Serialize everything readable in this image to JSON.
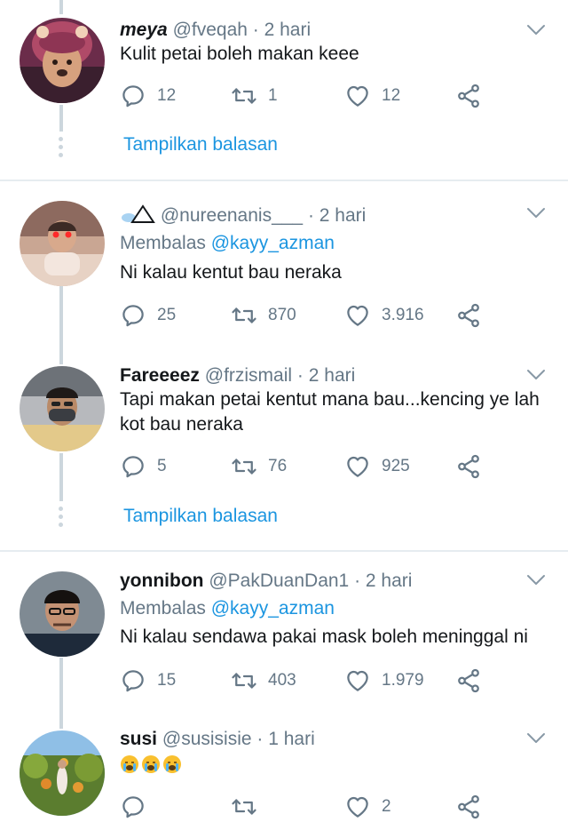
{
  "tweets": [
    {
      "name": "meya",
      "handle": "@fveqah",
      "time": "· 2 hari",
      "text": "Kulit petai boleh makan keee",
      "replies": "12",
      "retweets": "1",
      "likes": "12"
    },
    {
      "name": "",
      "handle": "@nureenanis___",
      "time": "· 2 hari",
      "reply_prefix": "Membalas",
      "reply_to": "@kayy_azman",
      "text": "Ni kalau kentut bau neraka",
      "replies": "25",
      "retweets": "870",
      "likes": "3.916"
    },
    {
      "name": "Fareeeez",
      "handle": "@frzismail",
      "time": "· 2 hari",
      "text": "Tapi makan petai kentut mana bau...kencing ye lah kot bau neraka",
      "replies": "5",
      "retweets": "76",
      "likes": "925"
    },
    {
      "name": "yonnibon",
      "handle": "@PakDuanDan1",
      "time": "· 2 hari",
      "reply_prefix": "Membalas",
      "reply_to": "@kayy_azman",
      "text": "Ni kalau sendawa pakai mask boleh meninggal ni",
      "replies": "15",
      "retweets": "403",
      "likes": "1.979"
    },
    {
      "name": "susi",
      "handle": "@susisisie",
      "time": "· 1 hari",
      "text": "",
      "replies": "",
      "retweets": "",
      "likes": "2"
    }
  ],
  "show_replies_label": "Tampilkan balasan",
  "icons": {
    "reply": "reply-icon",
    "retweet": "retweet-icon",
    "like": "heart-icon",
    "share": "share-icon",
    "menu": "chevron-down-icon"
  },
  "colors": {
    "accent": "#1b95e0",
    "muted": "#657786",
    "line": "#ccd6dd"
  }
}
